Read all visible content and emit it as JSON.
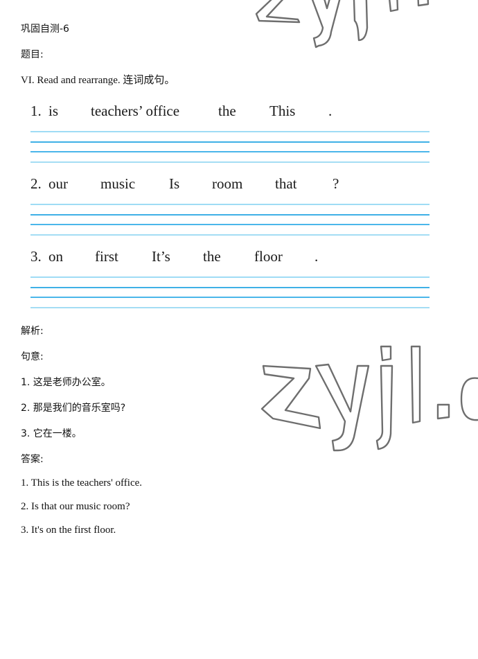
{
  "document": {
    "title": "巩固自测-6",
    "question_label": "题目:",
    "instruction": "VI. Read and rearrange. 连词成句。",
    "exercises": [
      {
        "number": "1.",
        "words": [
          "is",
          "teachers’ office",
          "the",
          "This",
          "."
        ]
      },
      {
        "number": "2.",
        "words": [
          "our",
          "music",
          "Is",
          "room",
          "that",
          "?"
        ]
      },
      {
        "number": "3.",
        "words": [
          "on",
          "first",
          "It’s",
          "the",
          "floor",
          "."
        ]
      }
    ],
    "analysis_label": "解析:",
    "meaning_label": "句意:",
    "meanings": [
      "1. 这是老师办公室。",
      "2. 那是我们的音乐室吗?",
      "3. 它在一楼。"
    ],
    "answer_label": "答案:",
    "answers": [
      "1. This is the teachers' office.",
      "2. Is that our music room?",
      "3. It's on the first floor."
    ]
  },
  "watermark": {
    "text": "zyjl.cn"
  },
  "colors": {
    "rule_light": "#9fdcf5",
    "rule_dark": "#3eb0e6",
    "watermark_stroke": "#6e6e6e"
  }
}
